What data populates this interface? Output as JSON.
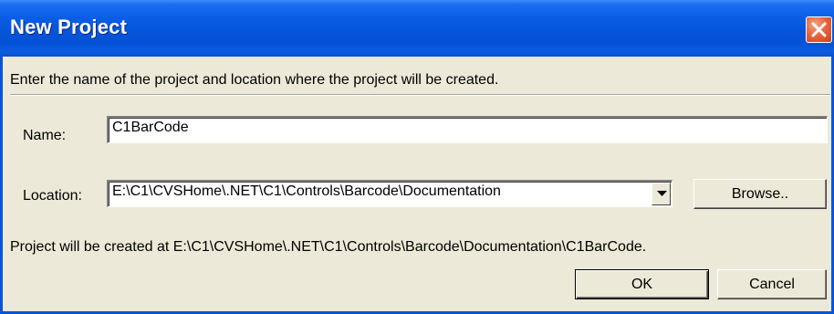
{
  "window": {
    "title": "New Project"
  },
  "instructions": "Enter the name of the project and location where the project will be created.",
  "name_field": {
    "label": "Name:",
    "value": "C1BarCode"
  },
  "location_field": {
    "label": "Location:",
    "value": "E:\\C1\\CVSHome\\.NET\\C1\\Controls\\Barcode\\Documentation"
  },
  "browse_label": "Browse..",
  "status_text": "Project will be created at E:\\C1\\CVSHome\\.NET\\C1\\Controls\\Barcode\\Documentation\\C1BarCode.",
  "buttons": {
    "ok_label": "OK",
    "cancel_label": "Cancel"
  },
  "colors": {
    "titlebar": "#0654d9",
    "dialog_bg": "#ece9d8",
    "close_button": "#e7663f"
  }
}
